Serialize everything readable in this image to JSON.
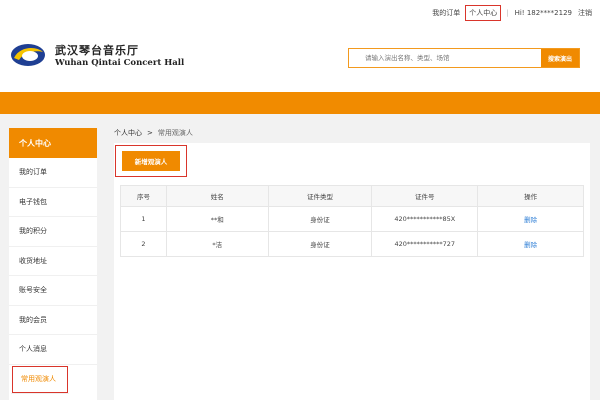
{
  "topbar": {
    "my_orders": "我的订单",
    "personal_center": "个人中心",
    "greeting": "Hi! 182****2129",
    "logout": "注销"
  },
  "logo": {
    "name_cn": "武汉琴台音乐厅",
    "name_en": "Wuhan Qintai Concert Hall"
  },
  "search": {
    "placeholder": "请输入演出名称、类型、场馆",
    "button": "搜索演出"
  },
  "sidebar": {
    "title": "个人中心",
    "items": [
      {
        "label": "我的订单"
      },
      {
        "label": "电子钱包"
      },
      {
        "label": "我的积分"
      },
      {
        "label": "收货地址"
      },
      {
        "label": "账号安全"
      },
      {
        "label": "我的会员"
      },
      {
        "label": "个人消息"
      },
      {
        "label": "常用观演人"
      }
    ]
  },
  "breadcrumb": {
    "root": "个人中心",
    "separator": ">",
    "current": "常用观演人"
  },
  "main": {
    "add_button": "新增观演人",
    "table": {
      "headers": [
        "序号",
        "姓名",
        "证件类型",
        "证件号",
        "操作"
      ],
      "rows": [
        {
          "no": "1",
          "name": "**和",
          "id_type": "身份证",
          "id_number": "420***********85X",
          "action": "删除"
        },
        {
          "no": "2",
          "name": "*洁",
          "id_type": "身份证",
          "id_number": "420***********727",
          "action": "删除"
        }
      ]
    }
  },
  "colors": {
    "accent": "#f08a00",
    "highlight": "#d9352b",
    "link": "#2f7fd6"
  }
}
